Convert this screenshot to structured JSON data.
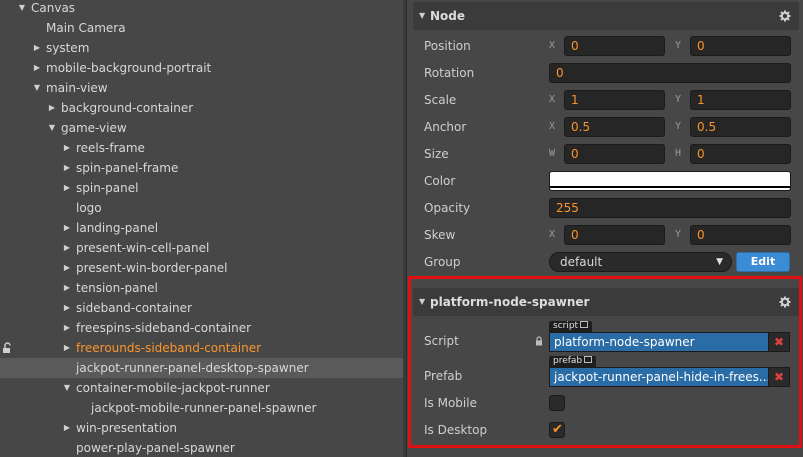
{
  "hierarchy": {
    "items": [
      {
        "label": "Canvas",
        "depth": 0,
        "arrow": "down"
      },
      {
        "label": "Main Camera",
        "depth": 1,
        "arrow": "none"
      },
      {
        "label": "system",
        "depth": 1,
        "arrow": "right"
      },
      {
        "label": "mobile-background-portrait",
        "depth": 1,
        "arrow": "right"
      },
      {
        "label": "main-view",
        "depth": 1,
        "arrow": "down"
      },
      {
        "label": "background-container",
        "depth": 2,
        "arrow": "right"
      },
      {
        "label": "game-view",
        "depth": 2,
        "arrow": "down"
      },
      {
        "label": "reels-frame",
        "depth": 3,
        "arrow": "right"
      },
      {
        "label": "spin-panel-frame",
        "depth": 3,
        "arrow": "right"
      },
      {
        "label": "spin-panel",
        "depth": 3,
        "arrow": "right"
      },
      {
        "label": "logo",
        "depth": 3,
        "arrow": "none"
      },
      {
        "label": "landing-panel",
        "depth": 3,
        "arrow": "right"
      },
      {
        "label": "present-win-cell-panel",
        "depth": 3,
        "arrow": "right"
      },
      {
        "label": "present-win-border-panel",
        "depth": 3,
        "arrow": "right"
      },
      {
        "label": "tension-panel",
        "depth": 3,
        "arrow": "right"
      },
      {
        "label": "sideband-container",
        "depth": 3,
        "arrow": "right"
      },
      {
        "label": "freespins-sideband-container",
        "depth": 3,
        "arrow": "right"
      },
      {
        "label": "freerounds-sideband-container",
        "depth": 3,
        "arrow": "right",
        "state": "orange",
        "locked": true
      },
      {
        "label": "jackpot-runner-panel-desktop-spawner",
        "depth": 3,
        "arrow": "none",
        "state": "highlighted"
      },
      {
        "label": "container-mobile-jackpot-runner",
        "depth": 3,
        "arrow": "down"
      },
      {
        "label": "jackpot-mobile-runner-panel-spawner",
        "depth": 4,
        "arrow": "none"
      },
      {
        "label": "win-presentation",
        "depth": 3,
        "arrow": "right"
      },
      {
        "label": "power-play-panel-spawner",
        "depth": 3,
        "arrow": "none"
      }
    ]
  },
  "node": {
    "title": "Node",
    "position": {
      "label": "Position",
      "x_axis": "X",
      "x": "0",
      "y_axis": "Y",
      "y": "0"
    },
    "rotation": {
      "label": "Rotation",
      "value": "0"
    },
    "scale": {
      "label": "Scale",
      "x_axis": "X",
      "x": "1",
      "y_axis": "Y",
      "y": "1"
    },
    "anchor": {
      "label": "Anchor",
      "x_axis": "X",
      "x": "0.5",
      "y_axis": "Y",
      "y": "0.5"
    },
    "size": {
      "label": "Size",
      "w_axis": "W",
      "w": "0",
      "h_axis": "H",
      "h": "0"
    },
    "color": {
      "label": "Color",
      "value": "#ffffff"
    },
    "opacity": {
      "label": "Opacity",
      "value": "255"
    },
    "skew": {
      "label": "Skew",
      "x_axis": "X",
      "x": "0",
      "y_axis": "Y",
      "y": "0"
    },
    "group": {
      "label": "Group",
      "value": "default",
      "edit_label": "Edit"
    }
  },
  "component": {
    "title": "platform-node-spawner",
    "script": {
      "label": "Script",
      "tag": "script",
      "value": "platform-node-spawner"
    },
    "prefab": {
      "label": "Prefab",
      "tag": "prefab",
      "value": "jackpot-runner-panel-hide-in-frees..."
    },
    "is_mobile": {
      "label": "Is Mobile",
      "checked": false
    },
    "is_desktop": {
      "label": "Is Desktop",
      "checked": true
    }
  },
  "colors": {
    "accent": "#fd942b",
    "asset_blue": "#2a6ca6",
    "edit_blue": "#3b8bd5",
    "highlight_red": "#e01010"
  }
}
